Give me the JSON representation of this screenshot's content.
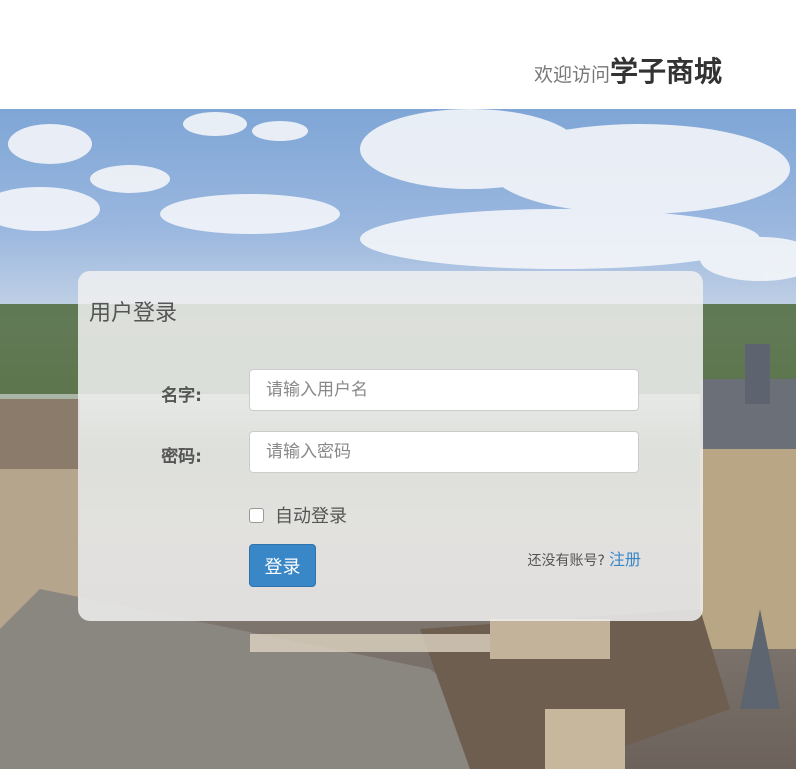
{
  "header": {
    "welcome_prefix": "欢迎访问",
    "brand": "学子商城"
  },
  "login": {
    "title": "用户登录",
    "username_label": "名字:",
    "username_placeholder": "请输入用户名",
    "password_label": "密码:",
    "password_placeholder": "请输入密码",
    "remember_label": "自动登录",
    "remember_checked": false,
    "submit_label": "登录",
    "register_hint": "还没有账号?",
    "register_link": "注册"
  },
  "colors": {
    "primary": "#3a87c8",
    "brand_text": "#333333",
    "panel_bg": "#f0f0f0"
  }
}
